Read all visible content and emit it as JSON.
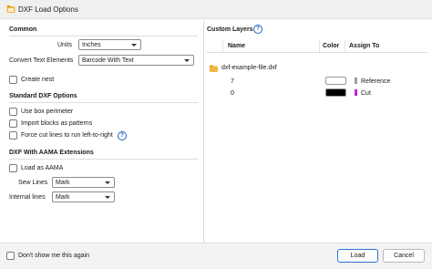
{
  "window": {
    "title": "DXF Load Options"
  },
  "common": {
    "heading": "Common",
    "units_label": "Units",
    "units_value": "Inches",
    "convert_label": "Convert Text Elements",
    "convert_value": "Barcode With Text",
    "create_nest_label": "Create nest"
  },
  "standard": {
    "heading": "Standard DXF Options",
    "box_perimeter_label": "Use box perimeter",
    "import_blocks_label": "Import blocks as patterns",
    "force_cut_label": "Force cut lines to run left-to-right",
    "help_glyph": "?"
  },
  "aama": {
    "heading": "DXF With AAMA Extensions",
    "load_aama_label": "Load as AAMA",
    "sew_lines_label": "Sew Lines",
    "sew_lines_value": "Mark",
    "internal_lines_label": "Internal lines",
    "internal_lines_value": "Mark"
  },
  "layers": {
    "heading": "Custom Layers",
    "help_glyph": "?",
    "columns": {
      "name": "Name",
      "color": "Color",
      "assign": "Assign To"
    },
    "file_name": "dxf-example-file.dxf",
    "rows": [
      {
        "name": "7",
        "color": "#ffffff",
        "assign_color": "#9e9e9e",
        "assign": "Reference"
      },
      {
        "name": "0",
        "color": "#000000",
        "assign_color": "#c81fd1",
        "assign": "Cut"
      }
    ]
  },
  "footer": {
    "dont_show_label": "Don't show me this again",
    "load_label": "Load",
    "cancel_label": "Cancel"
  },
  "colors": {
    "accent": "#2d6fd6",
    "folder": "#e8a93a"
  }
}
